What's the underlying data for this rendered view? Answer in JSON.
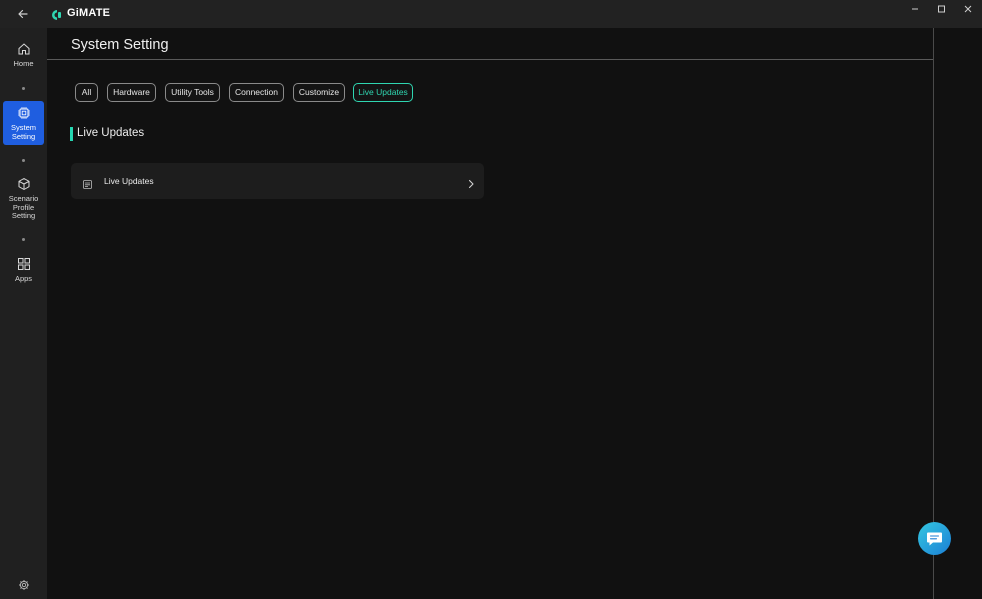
{
  "app": {
    "name": "GiMATE"
  },
  "sidebar": {
    "items": [
      {
        "label": "Home",
        "icon": "home-icon"
      },
      {
        "label": "System\nSetting",
        "icon": "chip-icon",
        "active": true
      },
      {
        "label": "Scenario\nProfile\nSetting",
        "icon": "cube-icon"
      },
      {
        "label": "Apps",
        "icon": "grid-icon"
      }
    ],
    "settings_icon": "gear-icon"
  },
  "page": {
    "title": "System Setting"
  },
  "tabs": [
    {
      "label": "All"
    },
    {
      "label": "Hardware"
    },
    {
      "label": "Utility Tools"
    },
    {
      "label": "Connection"
    },
    {
      "label": "Customize"
    },
    {
      "label": "Live Updates",
      "active": true
    }
  ],
  "section": {
    "title": "Live Updates"
  },
  "cards": [
    {
      "label": "Live Updates",
      "icon": "document-icon"
    }
  ],
  "colors": {
    "accent": "#2fd6b1",
    "nav_active": "#1f5ee0",
    "background": "#111111",
    "chat": "#1b7fd6"
  }
}
